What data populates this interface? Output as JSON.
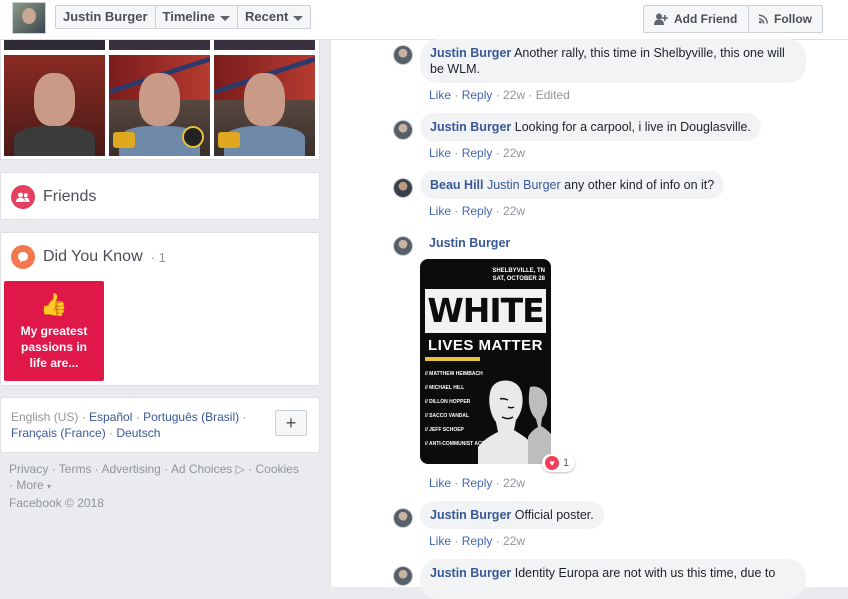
{
  "topbar": {
    "profile_name": "Justin Burger",
    "timeline_label": "Timeline",
    "recent_label": "Recent",
    "add_friend_label": "Add Friend",
    "follow_label": "Follow"
  },
  "sidebar": {
    "friends_title": "Friends",
    "did_you_know_title": "Did You Know",
    "did_you_know_count": "· 1",
    "did_you_know_tile_text": "My greatest passions in life are...",
    "languages": {
      "current": "English (US)",
      "links": [
        "Español",
        "Português (Brasil)",
        "Français (France)",
        "Deutsch"
      ]
    },
    "footer": {
      "links": [
        "Privacy",
        "Terms",
        "Advertising",
        "Ad Choices",
        "Cookies",
        "More"
      ],
      "copyright": "Facebook © 2018"
    }
  },
  "comments": [
    {
      "author": "Justin Burger",
      "text": "Another rally, this time in Shelbyville, this one will be WLM.",
      "time": "22w",
      "edited": "Edited"
    },
    {
      "author": "Justin Burger",
      "text": "Looking for a carpool, i live in Douglasville.",
      "time": "22w"
    },
    {
      "author": "Beau Hill",
      "mention": "Justin Burger",
      "text": "any other kind of info on it?",
      "time": "22w"
    },
    {
      "author": "Justin Burger",
      "text": "",
      "time": "22w",
      "reaction_count": "1"
    },
    {
      "author": "Justin Burger",
      "text": "Official poster.",
      "time": "22w"
    },
    {
      "author": "Justin Burger",
      "text": "Identity Europa are not with us this time, due to"
    }
  ],
  "actions": {
    "like": "Like",
    "reply": "Reply"
  },
  "poster": {
    "top_text": "SHELBYVILLE, TN",
    "date": "SAT, OCTOBER 28",
    "headline": "WHITE",
    "subhead": "LIVES MATTER",
    "speakers": [
      "// MATTHEW HEIMBACH",
      "// MICHAEL HILL",
      "// DILLON HOPPER",
      "// SACCO VANDAL",
      "// JEFF SCHOEP",
      "// ANTI-COMMUNIST ACTION"
    ]
  }
}
